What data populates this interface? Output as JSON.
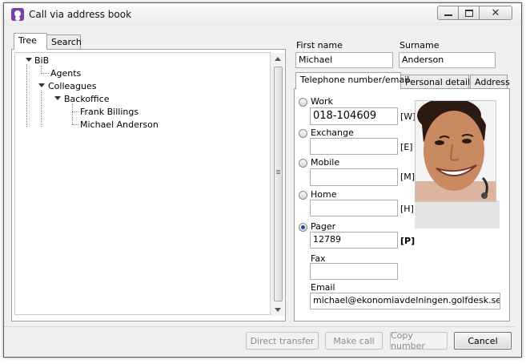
{
  "window": {
    "title": "Call via address book",
    "controls": {
      "minimize": "minimize",
      "maximize": "maximize",
      "close": "close"
    }
  },
  "left_tabs": [
    {
      "label": "Tree"
    },
    {
      "label": "Search"
    }
  ],
  "tree": {
    "nodes": [
      {
        "label": "BiB"
      },
      {
        "label": "Agents"
      },
      {
        "label": "Colleagues"
      },
      {
        "label": "Backoffice"
      },
      {
        "label": "Frank Billings"
      },
      {
        "label": "Michael Anderson"
      }
    ]
  },
  "contact": {
    "first_name_label": "First name",
    "first_name": "Michael",
    "surname_label": "Surname",
    "surname": "Anderson"
  },
  "right_tabs": [
    {
      "label": "Telephone number/email"
    },
    {
      "label": "Personal details"
    },
    {
      "label": "Address"
    }
  ],
  "phones": {
    "work": {
      "label": "Work",
      "value": "018-104609",
      "code": "[W]"
    },
    "exchange": {
      "label": "Exchange",
      "value": "",
      "code": "[E]"
    },
    "mobile": {
      "label": "Mobile",
      "value": "",
      "code": "[M]"
    },
    "home": {
      "label": "Home",
      "value": "",
      "code": "[H]"
    },
    "pager": {
      "label": "Pager",
      "value": "12789",
      "code": "[P]"
    },
    "fax": {
      "label": "Fax",
      "value": ""
    },
    "email": {
      "label": "Email",
      "value": "michael@ekonomiavdelningen.golfdesk.se"
    },
    "selected": "pager"
  },
  "buttons": {
    "direct_transfer": "Direct transfer",
    "make_call": "Make call",
    "copy_number": "Copy number",
    "cancel": "Cancel"
  },
  "colors": {
    "accent": "#1c4f9c",
    "app_icon": "#7a3fa8"
  }
}
